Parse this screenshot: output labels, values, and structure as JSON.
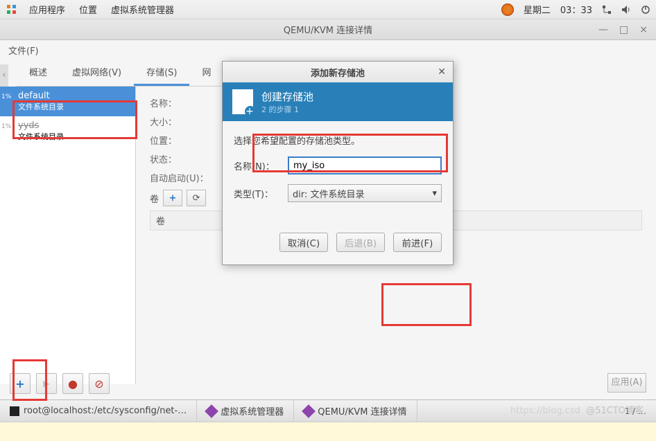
{
  "top_bar": {
    "app_menu": "应用程序",
    "location_menu": "位置",
    "vm_manager": "虚拟系统管理器",
    "day": "星期二",
    "time": "03：33"
  },
  "window": {
    "title": "QEMU/KVM 连接详情",
    "minimize": "—",
    "maximize": "□",
    "close": "×",
    "file_menu": "文件(F)"
  },
  "tabs": {
    "overview": "概述",
    "vnet": "虚拟网络(V)",
    "storage": "存储(S)",
    "netif": "网"
  },
  "sidebar": {
    "items": [
      {
        "pct": "1%",
        "name": "default",
        "sub": "文件系统目录"
      },
      {
        "pct": "1%",
        "name": "yyds",
        "sub": "文件系统目录"
      }
    ]
  },
  "details": {
    "name_label": "名称：",
    "size_label": "大小：",
    "location_label": "位置：",
    "state_label": "状态：",
    "autostart_label": "自动启动(U)：",
    "vol_label": "卷",
    "vol_header": "卷",
    "plus": "+",
    "refresh": "⟳"
  },
  "bottom": {
    "plus": "+",
    "play": "▶",
    "record": "●",
    "stop": "⊘",
    "apply": "应用(A)"
  },
  "taskbar": {
    "terminal": "root@localhost:/etc/sysconfig/net-…",
    "vm_manager": "虚拟系统管理器",
    "connection": "QEMU/KVM 连接详情",
    "count": "1 / …"
  },
  "modal": {
    "title": "添加新存储池",
    "header_title": "创建存储池",
    "header_sub": "2 的步骤 1",
    "desc": "选择您希望配置的存储池类型。",
    "name_label": "名称(N)：",
    "name_value": "my_iso",
    "type_label": "类型(T)：",
    "type_value": "dir: 文件系统目录",
    "dropdown_arrow": "▾",
    "cancel": "取消(C)",
    "back": "后退(B)",
    "forward": "前进(F)",
    "close_icon": "✕"
  },
  "watermark": "@51CTO博客",
  "watermark2": "https://blog.csd"
}
